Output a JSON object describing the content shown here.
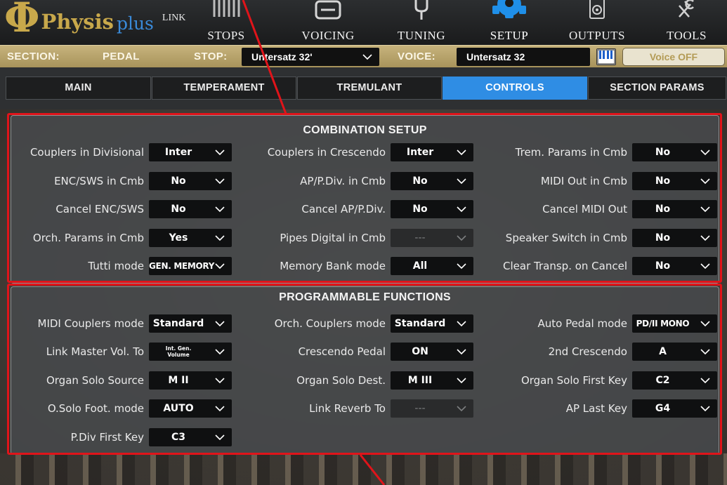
{
  "app": {
    "logo_main": "Physis",
    "logo_accent": "plus",
    "logo_link": "LINK"
  },
  "nav": [
    {
      "label": "STOPS",
      "icon": "organ-pipes-icon"
    },
    {
      "label": "VOICING",
      "icon": "voicing-icon"
    },
    {
      "label": "TUNING",
      "icon": "tuning-fork-icon"
    },
    {
      "label": "SETUP",
      "icon": "gear-icon",
      "active": true
    },
    {
      "label": "OUTPUTS",
      "icon": "speaker-icon"
    },
    {
      "label": "TOOLS",
      "icon": "tools-icon"
    }
  ],
  "section_bar": {
    "section_label": "SECTION:",
    "section_value": "PEDAL",
    "stop_label": "STOP:",
    "stop_value": "Untersatz 32'",
    "voice_label": "VOICE:",
    "voice_value": "Untersatz 32",
    "voice_off_button": "Voice OFF"
  },
  "tabs": [
    {
      "label": "MAIN"
    },
    {
      "label": "TEMPERAMENT"
    },
    {
      "label": "TREMULANT"
    },
    {
      "label": "CONTROLS",
      "active": true
    },
    {
      "label": "SECTION PARAMS"
    }
  ],
  "combination_setup": {
    "title": "COMBINATION SETUP",
    "rows": [
      [
        {
          "label": "Couplers in Divisional",
          "value": "Inter"
        },
        {
          "label": "Couplers in Crescendo",
          "value": "Inter"
        },
        {
          "label": "Trem. Params in Cmb",
          "value": "No"
        }
      ],
      [
        {
          "label": "ENC/SWS in Cmb",
          "value": "No"
        },
        {
          "label": "AP/P.Div. in Cmb",
          "value": "No"
        },
        {
          "label": "MIDI Out in Cmb",
          "value": "No"
        }
      ],
      [
        {
          "label": "Cancel ENC/SWS",
          "value": "No"
        },
        {
          "label": "Cancel AP/P.Div.",
          "value": "No"
        },
        {
          "label": "Cancel MIDI Out",
          "value": "No"
        }
      ],
      [
        {
          "label": "Orch. Params in Cmb",
          "value": "Yes"
        },
        {
          "label": "Pipes Digital in Cmb",
          "value": "---",
          "disabled": true
        },
        {
          "label": "Speaker Switch in Cmb",
          "value": "No"
        }
      ],
      [
        {
          "label": "Tutti mode",
          "value": "GEN. MEMORY"
        },
        {
          "label": "Memory Bank mode",
          "value": "All"
        },
        {
          "label": "Clear Transp. on Cancel",
          "value": "No"
        }
      ]
    ]
  },
  "programmable_functions": {
    "title": "PROGRAMMABLE FUNCTIONS",
    "rows": [
      [
        {
          "label": "MIDI Couplers mode",
          "value": "Standard"
        },
        {
          "label": "Orch. Couplers mode",
          "value": "Standard"
        },
        {
          "label": "Auto Pedal mode",
          "value": "PD/II MONO"
        }
      ],
      [
        {
          "label": "Link Master Vol. To",
          "value": "Int. Gen. Volume"
        },
        {
          "label": "Crescendo Pedal",
          "value": "ON"
        },
        {
          "label": "2nd Crescendo",
          "value": "A"
        }
      ],
      [
        {
          "label": "Organ Solo Source",
          "value": "M II"
        },
        {
          "label": "Organ Solo Dest.",
          "value": "M III"
        },
        {
          "label": "Organ Solo First Key",
          "value": "C2"
        }
      ],
      [
        {
          "label": "O.Solo Foot. mode",
          "value": "AUTO"
        },
        {
          "label": "Link Reverb To",
          "value": "---",
          "disabled": true
        },
        {
          "label": "AP Last Key",
          "value": "G4"
        }
      ],
      [
        {
          "label": "P.Div First Key",
          "value": "C3"
        }
      ]
    ]
  },
  "colors": {
    "accent_active_tab": "#2f8de4",
    "section_bar_gold": "#b8a46b",
    "highlight_outline": "#e0141a",
    "logo_gold": "#c8a84b"
  }
}
